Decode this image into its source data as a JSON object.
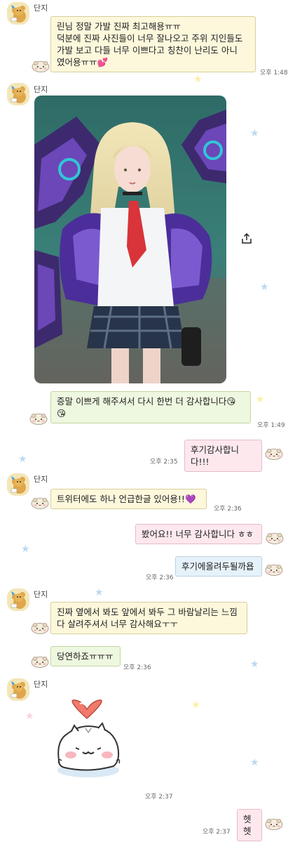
{
  "sender_name": "단지",
  "messages": [
    {
      "text": "린님 정말 가발 진짜 최고해용ㅠㅠ\n덕분에 진짜 사진들이 너무 잘나오고 주위 지인들도\n가발 보고 다들 너무 이쁘다고 칭찬이 난리도 아니\n였어용ㅠㅠ💕",
      "time": "오후 1:48"
    },
    {
      "text": "증말 이쁘게 해주셔서 다시 한번 더 감사합니다😘\n😘",
      "time": "오후 1:49"
    },
    {
      "text": "후기감사합니다!!!",
      "time": "오후 2:35"
    },
    {
      "text": "트위터에도 하나 언급한글 있어용!!💜",
      "time": "오후 2:36"
    },
    {
      "text": "봤어요!! 너무 감사합니다 ㅎㅎ",
      "time": ""
    },
    {
      "text": "후기에올려두될까욥",
      "time": "오후 2:36"
    },
    {
      "text": "진짜 옆에서 봐도 앞에서 봐두 그 바람날리는 느낌\n다 살려주셔서 너무 감사해요ㅜㅜ",
      "time": ""
    },
    {
      "text": "당연하죠ㅠㅠㅠ",
      "time": "오후 2:36"
    },
    {
      "text": "",
      "time": "오후 2:37"
    },
    {
      "text": "헷헷",
      "time": "오후 2:37"
    }
  ],
  "icons": {
    "share": "share-icon",
    "avatar": "bear-avatar-icon",
    "sticker": "hamster-sticker-icon",
    "star": "star-icon"
  },
  "colors": {
    "bubble_yellow": "#fdf8dc",
    "bubble_green": "#eef7df",
    "bubble_pink": "#fde8ee",
    "bubble_blue": "#e6f2fa",
    "star_blue": "#bcd9f0",
    "star_yellow": "#fbefa4",
    "star_pink": "#f7d3e0"
  }
}
